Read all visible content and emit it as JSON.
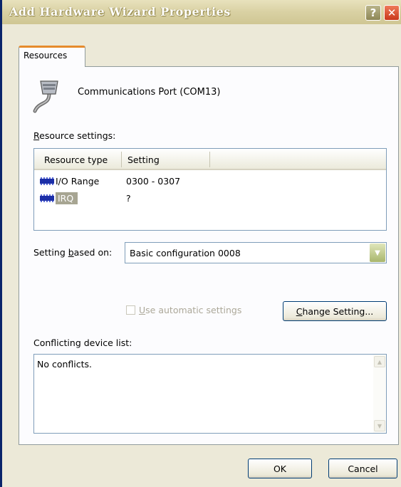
{
  "window": {
    "title": "Add Hardware Wizard Properties",
    "help_label": "?",
    "close_label": "✕"
  },
  "tabs": [
    {
      "label": "Resources",
      "active": true
    }
  ],
  "device": {
    "icon": "serial-port-icon",
    "name": "Communications Port (COM13)"
  },
  "resource_settings": {
    "label_accel": "R",
    "label_rest": "esource settings:",
    "columns": [
      "Resource type",
      "Setting"
    ],
    "rows": [
      {
        "type": "I/O Range",
        "setting": "0300 - 0307",
        "icon": "chip-icon",
        "selected": false
      },
      {
        "type": "IRQ",
        "setting": "?",
        "icon": "chip-icon",
        "selected": true
      }
    ]
  },
  "setting_based_on": {
    "label_pre": "Setting ",
    "label_accel": "b",
    "label_post": "ased on:",
    "value": "Basic configuration 0008"
  },
  "automatic": {
    "label_accel": "U",
    "label_rest": "se automatic settings",
    "checked": false,
    "enabled": false
  },
  "change_setting": {
    "label_accel": "C",
    "label_rest": "hange Setting..."
  },
  "conflicts": {
    "label": "Conflicting device list:",
    "text": "No conflicts."
  },
  "buttons": {
    "ok": "OK",
    "cancel": "Cancel"
  },
  "colors": {
    "titlebar": "#d9d1a3",
    "tab_accent": "#e68b2c",
    "selection": "#a7a592",
    "chip": "#1c2fa8"
  }
}
